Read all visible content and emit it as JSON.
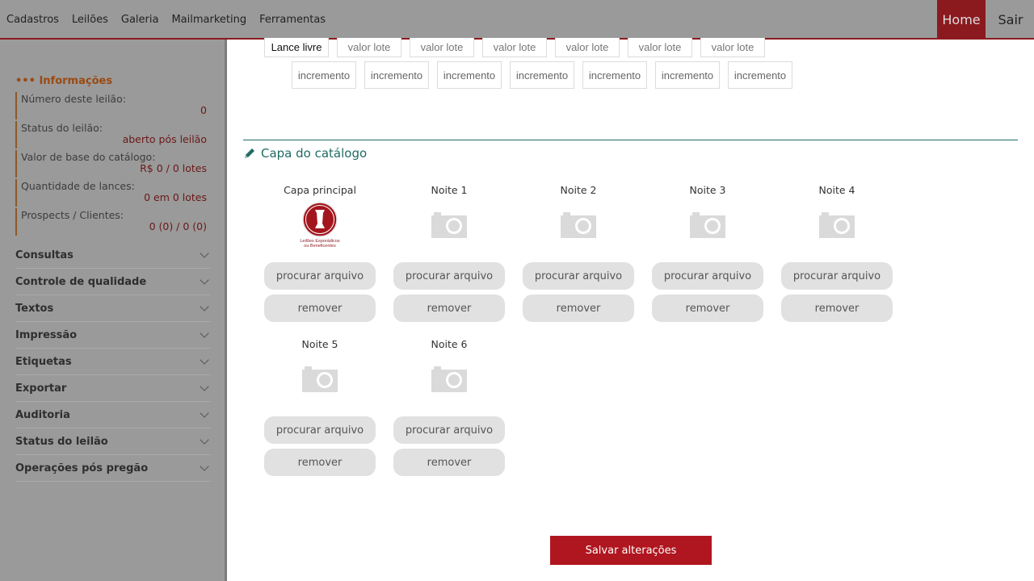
{
  "topbar": {
    "nav": [
      "Cadastros",
      "Leilões",
      "Galeria",
      "Mailmarketing",
      "Ferramentas"
    ],
    "home": "Home",
    "exit": "Sair"
  },
  "sidebar": {
    "info_title": "••• Informações",
    "info": [
      {
        "label": "Número deste leilão:",
        "value": "0"
      },
      {
        "label": "Status do leilão:",
        "value": "aberto pós leilão"
      },
      {
        "label": "Valor de base do catálogo:",
        "value": "R$ 0 / 0 lotes"
      },
      {
        "label": "Quantidade de lances:",
        "value": "0 em 0 lotes"
      },
      {
        "label": "Prospects / Clientes:",
        "value": "0 (0) / 0 (0)"
      }
    ],
    "menu": [
      "Consultas",
      "Controle de qualidade",
      "Textos",
      "Impressão",
      "Etiquetas",
      "Exportar",
      "Auditoria",
      "Status do leilão",
      "Operações pós pregão"
    ]
  },
  "bids": {
    "first": "Lance livre",
    "lot": "valor lote",
    "increment": "incremento"
  },
  "section": {
    "title": "Capa do catálogo"
  },
  "covers": {
    "labels": [
      "Capa principal",
      "Noite 1",
      "Noite 2",
      "Noite 3",
      "Noite 4",
      "Noite 5",
      "Noite 6"
    ],
    "browse": "procurar arquivo",
    "remove": "remover",
    "logo_text": "Leilões Esporádicos ou Beneficentes"
  },
  "save": "Salvar alterações",
  "colors": {
    "accent": "#8b1a1f",
    "save": "#b0161f",
    "section": "#1f6b63"
  }
}
